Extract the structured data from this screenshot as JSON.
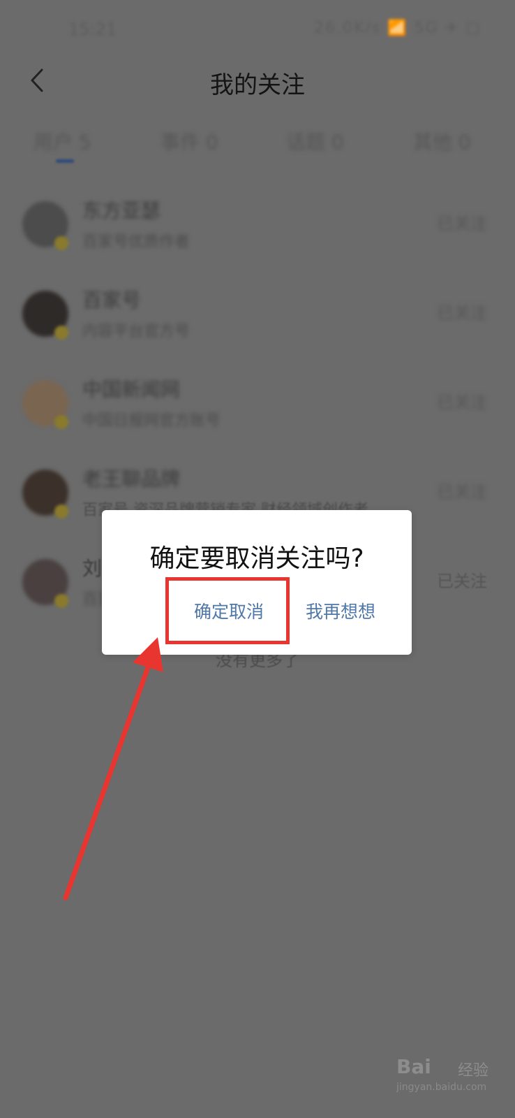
{
  "status_bar": {
    "time": "15:21",
    "icons": "26.0K/s 📶 5G ✈ ▢"
  },
  "header": {
    "title": "我的关注"
  },
  "tabs": [
    {
      "label": "用户 5"
    },
    {
      "label": "事件 0"
    },
    {
      "label": "话题 0"
    },
    {
      "label": "其他 0"
    }
  ],
  "list": {
    "rows": [
      {
        "name": "东方亚瑟",
        "desc": "百家号优质作者",
        "follow": "已关注"
      },
      {
        "name": "百家号",
        "desc": "内容平台官方号",
        "follow": "已关注"
      },
      {
        "name": "中国新闻网",
        "desc": "中国日报网官方账号",
        "follow": "已关注"
      },
      {
        "name": "老王聊品牌",
        "desc": "百家号 资深品牌营销专家 财经领域创作者",
        "follow": "已关注"
      },
      {
        "name": "刘",
        "desc": "百家号",
        "follow": "已关注"
      }
    ],
    "footer": "没有更多了"
  },
  "dialog": {
    "title": "确定要取消关注吗?",
    "confirm_label": "确定取消",
    "reconsider_label": "我再想想"
  },
  "watermark": {
    "logo": "Bai",
    "brand": "经验",
    "url": "jingyan.baidu.com"
  },
  "colors": {
    "overlay": "#6b6b6b",
    "button_text": "#4f78a8",
    "annotation_red": "#e83530"
  }
}
